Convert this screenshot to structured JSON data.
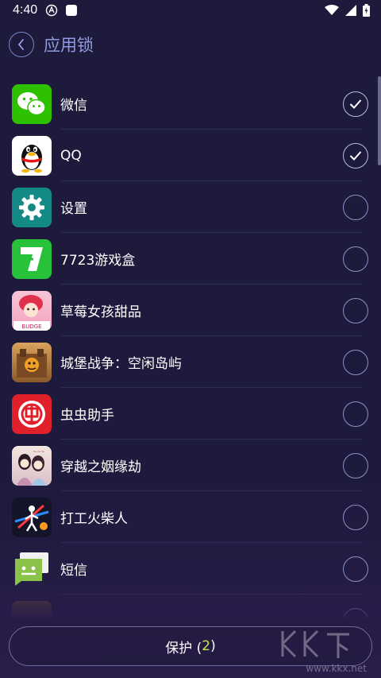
{
  "status_bar": {
    "time": "4:40"
  },
  "header": {
    "title": "应用锁"
  },
  "apps": [
    {
      "name": "微信",
      "checked": true,
      "icon": "wechat-icon"
    },
    {
      "name": "QQ",
      "checked": true,
      "icon": "qq-penguin-icon"
    },
    {
      "name": "设置",
      "checked": false,
      "icon": "gear-icon"
    },
    {
      "name": "7723游戏盒",
      "checked": false,
      "icon": "7723-icon"
    },
    {
      "name": "草莓女孩甜品",
      "checked": false,
      "icon": "strawberry-girl-icon"
    },
    {
      "name": "城堡战争：空闲岛屿",
      "checked": false,
      "icon": "castle-war-icon"
    },
    {
      "name": "虫虫助手",
      "checked": false,
      "icon": "chongchong-icon"
    },
    {
      "name": "穿越之姻缘劫",
      "checked": false,
      "icon": "romance-game-icon"
    },
    {
      "name": "打工火柴人",
      "checked": false,
      "icon": "stickman-icon"
    },
    {
      "name": "短信",
      "checked": false,
      "icon": "sms-icon"
    },
    {
      "name": "",
      "checked": false,
      "icon": "partial-app-icon"
    }
  ],
  "protect_button": {
    "label": "保护 (",
    "count": "2",
    "suffix": ")"
  },
  "watermark": {
    "text": "www.kkx.net"
  },
  "colors": {
    "background": "#1d1a3c",
    "accent": "#8f9be0",
    "count": "#c6ea48"
  }
}
